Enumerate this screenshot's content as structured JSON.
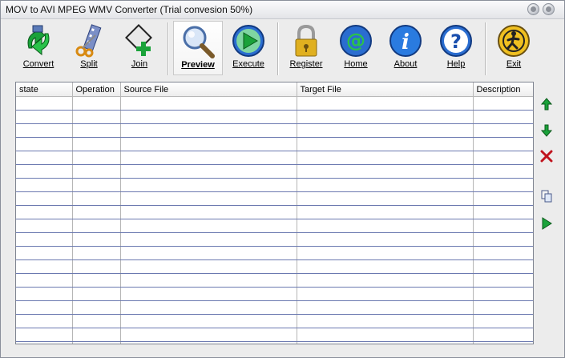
{
  "window": {
    "title": "MOV to AVI MPEG WMV Converter (Trial convesion 50%)"
  },
  "toolbar": {
    "convert": "Convert",
    "split": "Split",
    "join": "Join",
    "preview": "Preview",
    "execute": "Execute",
    "register": "Register",
    "home": "Home",
    "about": "About",
    "help": "Help",
    "exit": "Exit"
  },
  "grid": {
    "columns": [
      "state",
      "Operation",
      "Source File",
      "Target File",
      "Description"
    ],
    "rows": []
  },
  "icons": {
    "convert": "convert-icon",
    "split": "split-icon",
    "join": "join-icon",
    "preview": "magnifier-icon",
    "execute": "play-icon",
    "register": "padlock-icon",
    "home": "at-sign-icon",
    "about": "info-icon",
    "help": "question-icon",
    "exit": "exit-runner-icon",
    "side": [
      "arrow-up-icon",
      "arrow-down-icon",
      "delete-icon",
      "copy-icon",
      "run-icon"
    ]
  },
  "colors": {
    "accent_green": "#1aa23a",
    "accent_blue": "#1a64c8",
    "delete_red": "#c0141e",
    "lock_gold": "#e0b020"
  }
}
